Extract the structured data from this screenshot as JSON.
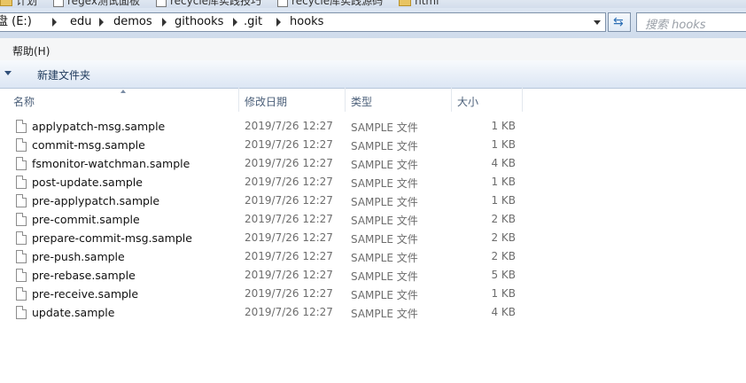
{
  "bookmarks": [
    {
      "label": "计划",
      "kind": "folder"
    },
    {
      "label": "regex测试面板",
      "kind": "page"
    },
    {
      "label": "recycle库实践技巧",
      "kind": "page"
    },
    {
      "label": "recycle库实践源码",
      "kind": "page"
    },
    {
      "label": "html",
      "kind": "folder"
    }
  ],
  "address": {
    "crumbs": [
      "盘 (E:)",
      "edu",
      "demos",
      "githooks",
      ".git",
      "hooks"
    ]
  },
  "search": {
    "placeholder": "搜索 hooks"
  },
  "menu": {
    "help_label": "帮助(H)"
  },
  "toolbar": {
    "new_folder_label": "新建文件夹"
  },
  "columns": {
    "name": "名称",
    "date": "修改日期",
    "type": "类型",
    "size": "大小"
  },
  "files": [
    {
      "name": "applypatch-msg.sample",
      "date": "2019/7/26 12:27",
      "type": "SAMPLE 文件",
      "size": "1 KB"
    },
    {
      "name": "commit-msg.sample",
      "date": "2019/7/26 12:27",
      "type": "SAMPLE 文件",
      "size": "1 KB"
    },
    {
      "name": "fsmonitor-watchman.sample",
      "date": "2019/7/26 12:27",
      "type": "SAMPLE 文件",
      "size": "4 KB"
    },
    {
      "name": "post-update.sample",
      "date": "2019/7/26 12:27",
      "type": "SAMPLE 文件",
      "size": "1 KB"
    },
    {
      "name": "pre-applypatch.sample",
      "date": "2019/7/26 12:27",
      "type": "SAMPLE 文件",
      "size": "1 KB"
    },
    {
      "name": "pre-commit.sample",
      "date": "2019/7/26 12:27",
      "type": "SAMPLE 文件",
      "size": "2 KB"
    },
    {
      "name": "prepare-commit-msg.sample",
      "date": "2019/7/26 12:27",
      "type": "SAMPLE 文件",
      "size": "2 KB"
    },
    {
      "name": "pre-push.sample",
      "date": "2019/7/26 12:27",
      "type": "SAMPLE 文件",
      "size": "2 KB"
    },
    {
      "name": "pre-rebase.sample",
      "date": "2019/7/26 12:27",
      "type": "SAMPLE 文件",
      "size": "5 KB"
    },
    {
      "name": "pre-receive.sample",
      "date": "2019/7/26 12:27",
      "type": "SAMPLE 文件",
      "size": "1 KB"
    },
    {
      "name": "update.sample",
      "date": "2019/7/26 12:27",
      "type": "SAMPLE 文件",
      "size": "4 KB"
    }
  ]
}
